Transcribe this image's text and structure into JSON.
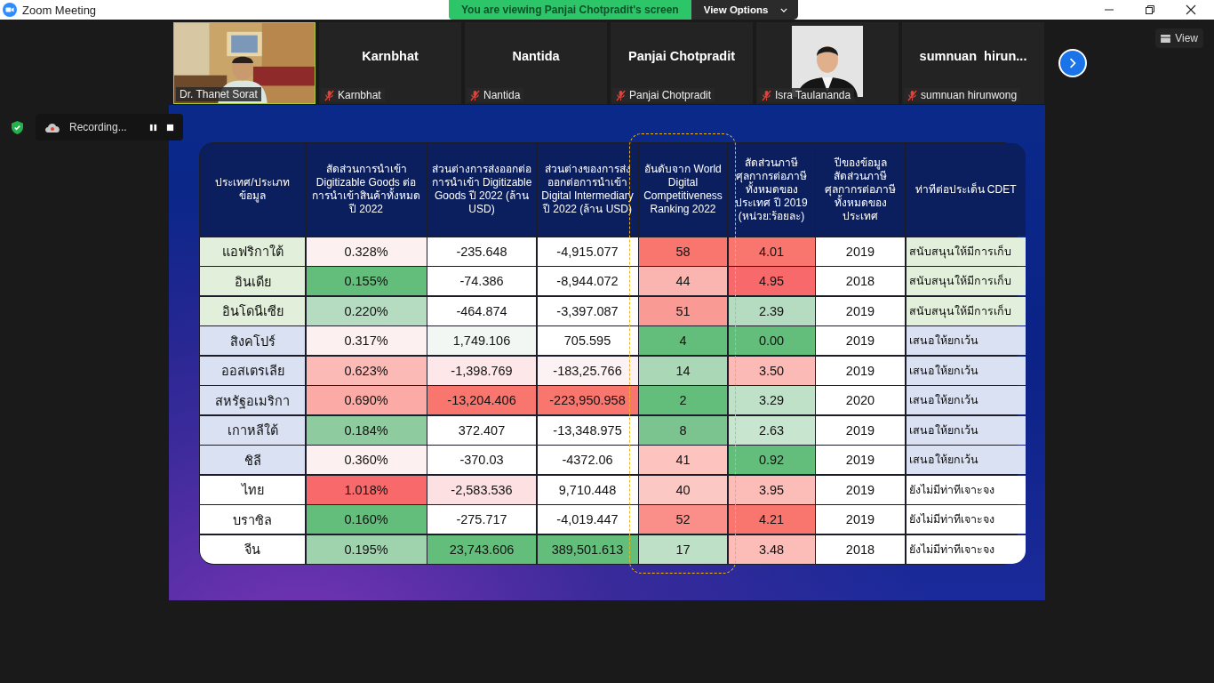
{
  "window": {
    "title": "Zoom Meeting"
  },
  "share_banner": {
    "text": "You are viewing Panjai Chotpradit's screen",
    "options_label": "View Options"
  },
  "participants": [
    {
      "kind": "video",
      "name": "Dr. Thanet Sorat",
      "muted": false,
      "selected": true
    },
    {
      "kind": "name",
      "display": "Karnbhat",
      "name": "Karnbhat",
      "muted": true,
      "selected": false
    },
    {
      "kind": "name",
      "display": "Nantida",
      "name": "Nantida",
      "muted": true,
      "selected": false
    },
    {
      "kind": "name",
      "display": "Panjai Chotpradit",
      "name": "Panjai Chotpradit",
      "muted": true,
      "selected": false
    },
    {
      "name": "Isra Taulananda",
      "muted": true,
      "selected": false
    },
    {
      "kind": "name",
      "display": "sumnuan  hirun...",
      "name": "sumnuan hirunwong",
      "muted": true,
      "selected": false
    }
  ],
  "view_button": "View",
  "recording": {
    "label": "Recording..."
  },
  "table": {
    "columns": [
      {
        "text": "ประเทศ/ประเภทข้อมูล",
        "highlighted": false
      },
      {
        "text": "สัดส่วนการนำเข้า Digitizable Goods ต่อการนำเข้าสินค้าทั้งหมด ปี 2022",
        "highlighted": false
      },
      {
        "text": "ส่วนต่างการส่งออกต่อการนำเข้า Digitizable Goods ปี 2022 (ล้าน USD)",
        "highlighted": false
      },
      {
        "text": "ส่วนต่างของการส่งออกต่อการนำเข้า Digital Intermediary ปี 2022 (ล้าน USD)",
        "highlighted": false
      },
      {
        "text": "อันดับจาก World Digital Competitiveness Ranking 2022",
        "highlighted": true
      },
      {
        "text": "สัดส่วนภาษีศุลกากรต่อภาษีทั้งหมดของประเทศ ปี 2019 (หน่วย:ร้อยละ)",
        "highlighted": false
      },
      {
        "text": "ปีของข้อมูลสัดส่วนภาษีศุลกากรต่อภาษีทั้งหมดของประเทศ",
        "highlighted": false
      },
      {
        "text": "ท่าทีต่อประเด็น CDET",
        "highlighted": false
      }
    ],
    "rows": [
      {
        "cells": [
          {
            "text": "แอฟริกาใต้",
            "color": "#e2efda"
          },
          {
            "text": "0.328%",
            "color": "#fdf0f1"
          },
          {
            "text": "-235.648",
            "color": "#ffffff"
          },
          {
            "text": "-4,915.077",
            "color": "#ffffff"
          },
          {
            "text": "58",
            "color": "#f8766d"
          },
          {
            "text": "4.01",
            "color": "#f8766d"
          },
          {
            "text": "2019",
            "color": "#ffffff"
          },
          {
            "text": "สนับสนุนให้มีการเก็บ",
            "color": "#e2efda"
          }
        ]
      },
      {
        "cells": [
          {
            "text": "อินเดีย",
            "color": "#e2efda"
          },
          {
            "text": "0.155%",
            "color": "#63be7b"
          },
          {
            "text": "-74.386",
            "color": "#ffffff"
          },
          {
            "text": "-8,944.072",
            "color": "#ffffff"
          },
          {
            "text": "44",
            "color": "#fbb5b0"
          },
          {
            "text": "4.95",
            "color": "#f8696b"
          },
          {
            "text": "2018",
            "color": "#ffffff"
          },
          {
            "text": "สนับสนุนให้มีการเก็บ",
            "color": "#e2efda"
          }
        ]
      },
      {
        "cells": [
          {
            "text": "อินโดนีเซีย",
            "color": "#e2efda"
          },
          {
            "text": "0.220%",
            "color": "#b5dcc0"
          },
          {
            "text": "-464.874",
            "color": "#ffffff"
          },
          {
            "text": "-3,397.087",
            "color": "#ffffff"
          },
          {
            "text": "51",
            "color": "#fa9a94"
          },
          {
            "text": "2.39",
            "color": "#b5dcc0"
          },
          {
            "text": "2019",
            "color": "#ffffff"
          },
          {
            "text": "สนับสนุนให้มีการเก็บ",
            "color": "#e2efda"
          }
        ]
      },
      {
        "cells": [
          {
            "text": "สิงคโปร์",
            "color": "#d9e1f2"
          },
          {
            "text": "0.317%",
            "color": "#fdf0f1"
          },
          {
            "text": "1,749.106",
            "color": "#f3f7f4"
          },
          {
            "text": "705.595",
            "color": "#ffffff"
          },
          {
            "text": "4",
            "color": "#63be7b"
          },
          {
            "text": "0.00",
            "color": "#63be7b"
          },
          {
            "text": "2019",
            "color": "#ffffff"
          },
          {
            "text": "เสนอให้ยกเว้น",
            "color": "#d9e1f2"
          }
        ]
      },
      {
        "cells": [
          {
            "text": "ออสเตรเลีย",
            "color": "#d9e1f2"
          },
          {
            "text": "0.623%",
            "color": "#fbbab6"
          },
          {
            "text": "-1,398.769",
            "color": "#fde7e8"
          },
          {
            "text": "-183,25.766",
            "color": "#fdf2f3"
          },
          {
            "text": "14",
            "color": "#aad7b6"
          },
          {
            "text": "3.50",
            "color": "#fbbab6"
          },
          {
            "text": "2019",
            "color": "#ffffff"
          },
          {
            "text": "เสนอให้ยกเว้น",
            "color": "#d9e1f2"
          }
        ]
      },
      {
        "cells": [
          {
            "text": "สหรัฐอเมริกา",
            "color": "#d9e1f2"
          },
          {
            "text": "0.690%",
            "color": "#fbaaa5"
          },
          {
            "text": "-13,204.406",
            "color": "#f8766d"
          },
          {
            "text": "-223,950.958",
            "color": "#f8766d"
          },
          {
            "text": "2",
            "color": "#63be7b"
          },
          {
            "text": "3.29",
            "color": "#bfe1c8"
          },
          {
            "text": "2020",
            "color": "#ffffff"
          },
          {
            "text": "เสนอให้ยกเว้น",
            "color": "#d9e1f2"
          }
        ]
      },
      {
        "cells": [
          {
            "text": "เกาหลีใต้",
            "color": "#d9e1f2"
          },
          {
            "text": "0.184%",
            "color": "#8ecc9f"
          },
          {
            "text": "372.407",
            "color": "#ffffff"
          },
          {
            "text": "-13,348.975",
            "color": "#ffffff"
          },
          {
            "text": "8",
            "color": "#7cc48f"
          },
          {
            "text": "2.63",
            "color": "#c8e5cf"
          },
          {
            "text": "2019",
            "color": "#ffffff"
          },
          {
            "text": "เสนอให้ยกเว้น",
            "color": "#d9e1f2"
          }
        ]
      },
      {
        "cells": [
          {
            "text": "ชิลี",
            "color": "#d9e1f2"
          },
          {
            "text": "0.360%",
            "color": "#fdf0f1"
          },
          {
            "text": "-370.03",
            "color": "#ffffff"
          },
          {
            "text": "-4372.06",
            "color": "#ffffff"
          },
          {
            "text": "41",
            "color": "#fcc3bf"
          },
          {
            "text": "0.92",
            "color": "#63be7b"
          },
          {
            "text": "2019",
            "color": "#ffffff"
          },
          {
            "text": "เสนอให้ยกเว้น",
            "color": "#d9e1f2"
          }
        ]
      },
      {
        "cells": [
          {
            "text": "ไทย",
            "color": "#ffffff"
          },
          {
            "text": "1.018%",
            "color": "#f8696b"
          },
          {
            "text": "-2,583.536",
            "color": "#fde1e2"
          },
          {
            "text": "9,710.448",
            "color": "#ffffff"
          },
          {
            "text": "40",
            "color": "#fcc8c4"
          },
          {
            "text": "3.95",
            "color": "#fcbcb8"
          },
          {
            "text": "2019",
            "color": "#ffffff"
          },
          {
            "text": "ยังไม่มีท่าทีเจาะจง",
            "color": "#ffffff"
          }
        ]
      },
      {
        "cells": [
          {
            "text": "บราซิล",
            "color": "#ffffff"
          },
          {
            "text": "0.160%",
            "color": "#63be7b"
          },
          {
            "text": "-275.717",
            "color": "#ffffff"
          },
          {
            "text": "-4,019.447",
            "color": "#ffffff"
          },
          {
            "text": "52",
            "color": "#fa8f89"
          },
          {
            "text": "4.21",
            "color": "#f8766d"
          },
          {
            "text": "2019",
            "color": "#ffffff"
          },
          {
            "text": "ยังไม่มีท่าทีเจาะจง",
            "color": "#ffffff"
          }
        ]
      },
      {
        "cells": [
          {
            "text": "จีน",
            "color": "#ffffff"
          },
          {
            "text": "0.195%",
            "color": "#9fd3ad"
          },
          {
            "text": "23,743.606",
            "color": "#63be7b"
          },
          {
            "text": "389,501.613",
            "color": "#63be7b"
          },
          {
            "text": "17",
            "color": "#bde0c6"
          },
          {
            "text": "3.48",
            "color": "#fcbcb8"
          },
          {
            "text": "2018",
            "color": "#ffffff"
          },
          {
            "text": "ยังไม่มีท่าทีเจาะจง",
            "color": "#ffffff"
          }
        ]
      }
    ]
  }
}
